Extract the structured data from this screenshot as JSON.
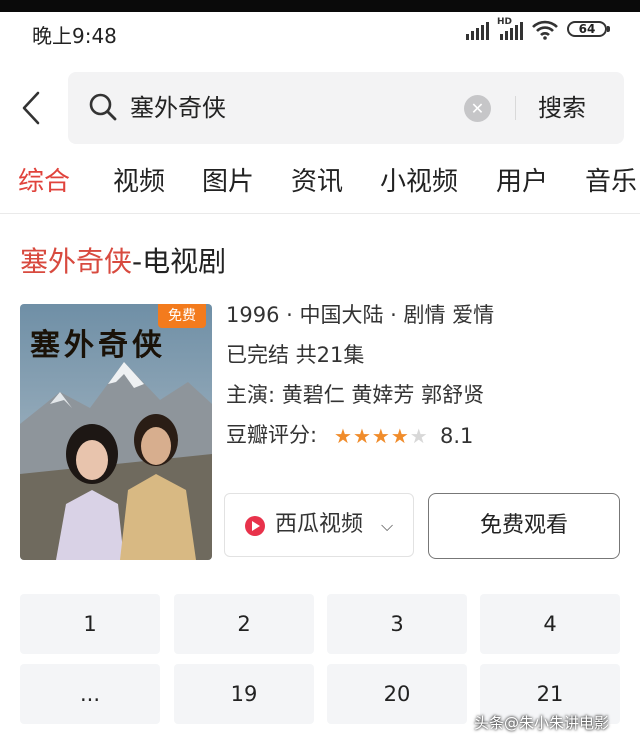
{
  "status_bar": {
    "time": "晚上9:48",
    "network": "HD",
    "battery": "64"
  },
  "search": {
    "query": "塞外奇侠",
    "button_label": "搜索"
  },
  "tabs": [
    {
      "label": "综合",
      "active": true
    },
    {
      "label": "视频",
      "active": false
    },
    {
      "label": "图片",
      "active": false
    },
    {
      "label": "资讯",
      "active": false
    },
    {
      "label": "小视频",
      "active": false
    },
    {
      "label": "用户",
      "active": false
    },
    {
      "label": "音乐",
      "active": false
    }
  ],
  "result": {
    "title_main": "塞外奇侠",
    "title_suffix": "-电视剧",
    "poster": {
      "badge": "免费",
      "title_art": "塞外奇侠"
    },
    "info_line": "1996 · 中国大陆 · 剧情 爱情",
    "status_line": "已完结 共21集",
    "cast_line": "主演: 黄碧仁 黄婞芳 郭舒贤",
    "rating_label": "豆瓣评分:",
    "rating_stars": 4,
    "rating_max_stars": 5,
    "rating_score": "8.1",
    "source": {
      "label": "西瓜视频",
      "chevron": "⌵"
    },
    "watch_button": "免费观看",
    "episodes": [
      "1",
      "2",
      "3",
      "4",
      "...",
      "19",
      "20",
      "21"
    ]
  },
  "watermark": "头条@朱小朱讲电影",
  "colors": {
    "accent": "#e0433c",
    "title_accent": "#d84a3f",
    "badge": "#f37b1d",
    "star_on": "#f08c2b",
    "star_off": "#d8d8d8",
    "source_logo": "#e8324b"
  },
  "icons": [
    "back-arrow-icon",
    "search-icon",
    "clear-icon",
    "signal-icon",
    "wifi-icon",
    "battery-icon",
    "star-icon",
    "xigua-logo-icon",
    "chevron-down-icon"
  ]
}
